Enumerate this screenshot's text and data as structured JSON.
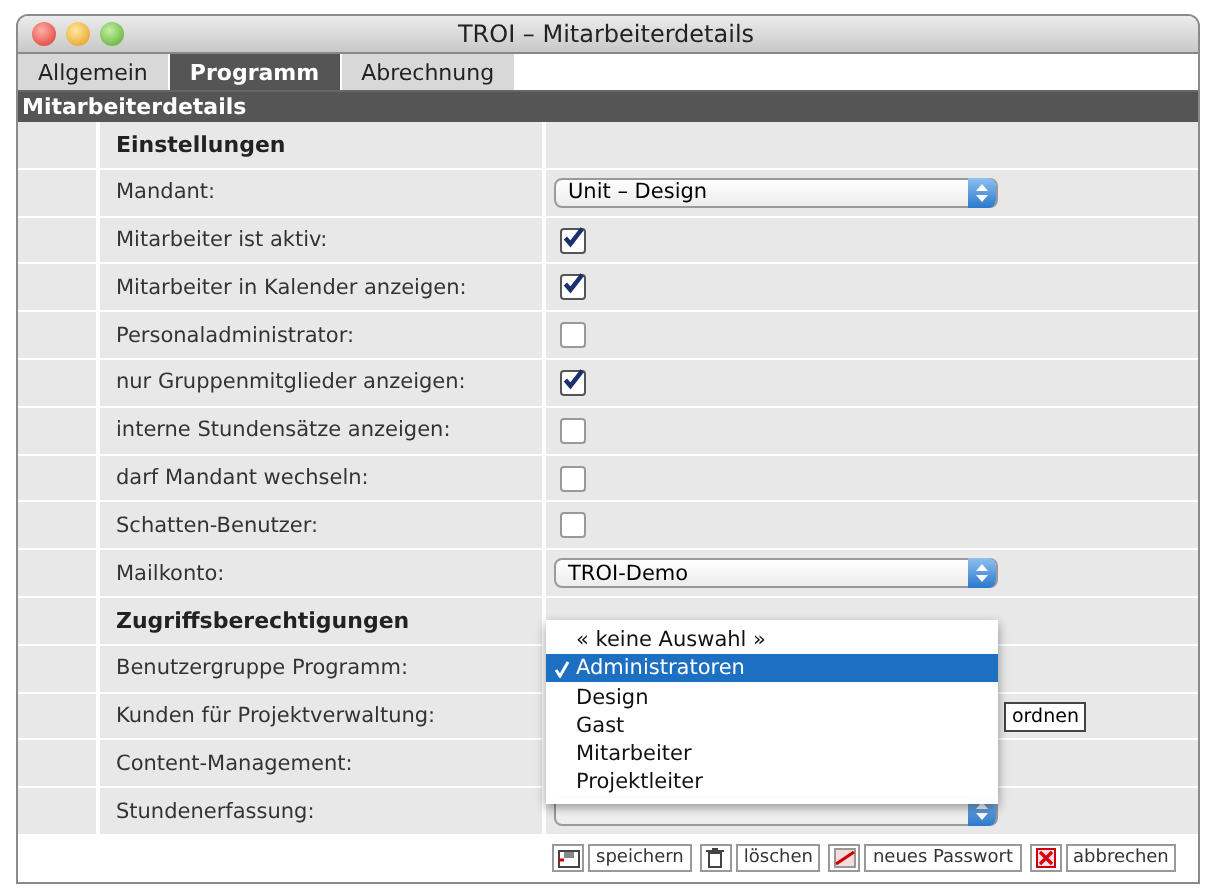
{
  "window": {
    "title": "TROI – Mitarbeiterdetails"
  },
  "tabs": [
    {
      "label": "Allgemein",
      "selected": false
    },
    {
      "label": "Programm",
      "selected": true
    },
    {
      "label": "Abrechnung",
      "selected": false
    }
  ],
  "section_title": "Mitarbeiterdetails",
  "rows": [
    {
      "kind": "heading",
      "label": "Einstellungen"
    },
    {
      "kind": "select",
      "label": "Mandant:",
      "value": "Unit – Design"
    },
    {
      "kind": "checkbox",
      "label": "Mitarbeiter ist aktiv:",
      "checked": true
    },
    {
      "kind": "checkbox",
      "label": "Mitarbeiter in Kalender anzeigen:",
      "checked": true
    },
    {
      "kind": "checkbox",
      "label": "Personaladministrator:",
      "checked": false
    },
    {
      "kind": "checkbox",
      "label": "nur Gruppenmitglieder anzeigen:",
      "checked": true
    },
    {
      "kind": "checkbox",
      "label": "interne Stundensätze anzeigen:",
      "checked": false
    },
    {
      "kind": "checkbox",
      "label": "darf Mandant wechseln:",
      "checked": false
    },
    {
      "kind": "checkbox",
      "label": "Schatten-Benutzer:",
      "checked": false
    },
    {
      "kind": "select",
      "label": "Mailkonto:",
      "value": "TROI-Demo"
    },
    {
      "kind": "heading",
      "label": "Zugriffsberechtigungen"
    },
    {
      "kind": "menu",
      "label": "Benutzergruppe Programm:",
      "options": [
        {
          "label": "« keine Auswahl »",
          "selected": false
        },
        {
          "label": "Administratoren",
          "selected": true
        },
        {
          "label": "Design",
          "selected": false
        },
        {
          "label": "Gast",
          "selected": false
        },
        {
          "label": "Mitarbeiter",
          "selected": false
        },
        {
          "label": "Projektleiter",
          "selected": false
        }
      ]
    },
    {
      "kind": "button",
      "label": "Kunden für Projektverwaltung:",
      "button": "ordnen"
    },
    {
      "kind": "covered",
      "label": "Content-Management:"
    },
    {
      "kind": "select",
      "label": "Stundenerfassung:"
    }
  ],
  "actions": [
    {
      "kind": "save",
      "label": "speichern"
    },
    {
      "kind": "delete",
      "label": "löschen"
    },
    {
      "kind": "password",
      "label": "neues Passwort"
    },
    {
      "kind": "cancel",
      "label": "abbrechen"
    }
  ]
}
